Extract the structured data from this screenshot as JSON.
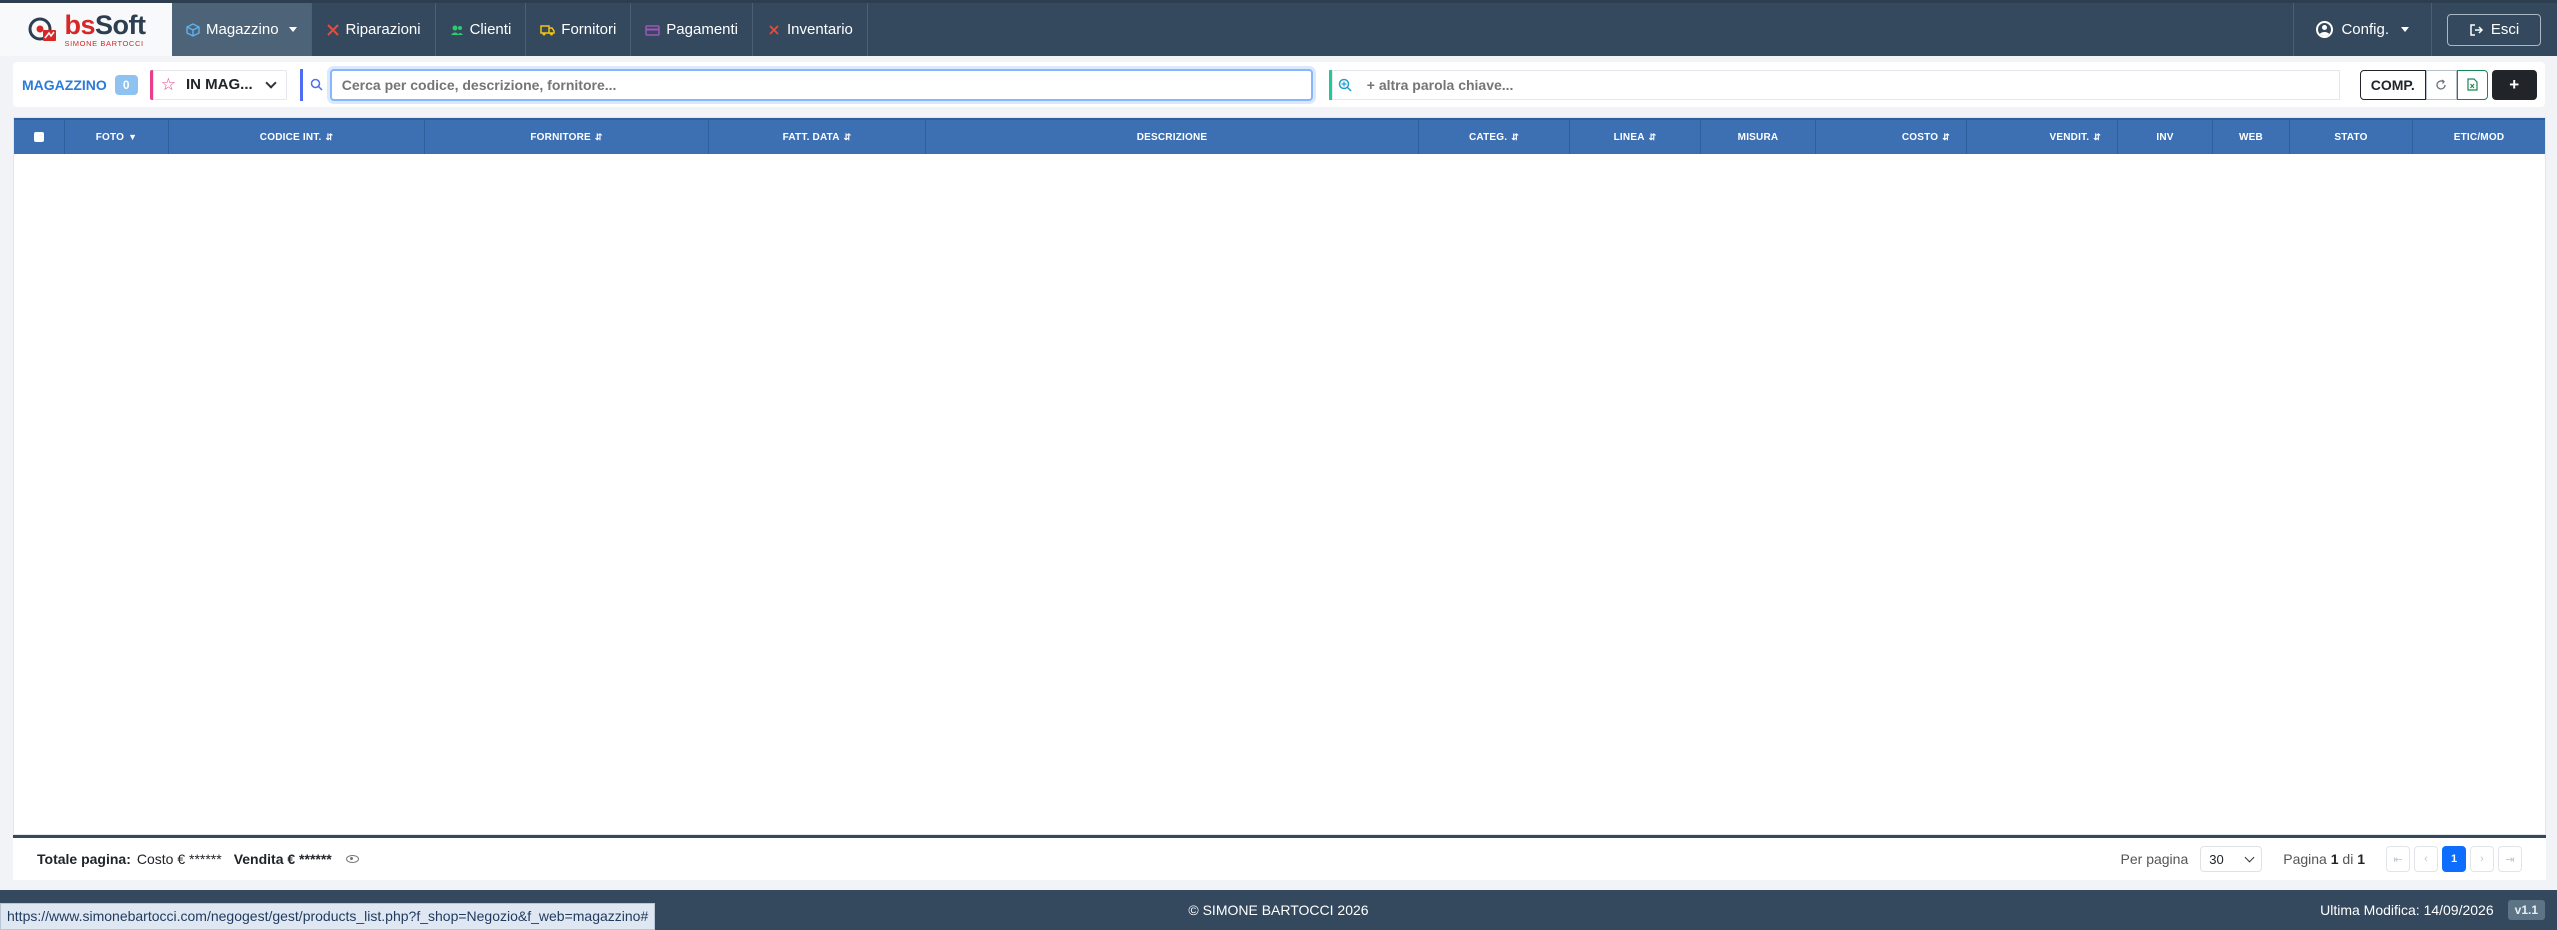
{
  "brand": {
    "name_prefix": "bs",
    "name_suffix": "Soft",
    "subtitle": "SIMONE BARTOCCI"
  },
  "nav": {
    "items": [
      {
        "label": "Magazzino",
        "icon": "box-icon",
        "color": "#5fb0f0",
        "active": true,
        "dropdown": true
      },
      {
        "label": "Riparazioni",
        "icon": "tools-icon",
        "color": "#e74c3c"
      },
      {
        "label": "Clienti",
        "icon": "users-icon",
        "color": "#2ecc71"
      },
      {
        "label": "Fornitori",
        "icon": "truck-icon",
        "color": "#f1c40f"
      },
      {
        "label": "Pagamenti",
        "icon": "card-icon",
        "color": "#9b59b6"
      },
      {
        "label": "Inventario",
        "icon": "clipboard-icon",
        "color": "#e74c3c"
      }
    ],
    "config_label": "Config.",
    "logout_label": "Esci"
  },
  "toolbar": {
    "section_label": "MAGAZZINO",
    "count": "0",
    "filter_label": "IN MAG...",
    "search_placeholder": "Cerca per codice, descrizione, fornitore...",
    "keyword_placeholder": "+ altra parola chiave...",
    "comp_label": "COMP.",
    "add_label": "+"
  },
  "table": {
    "columns": [
      {
        "label": "",
        "key": "select"
      },
      {
        "label": "FOTO",
        "sort": "▼"
      },
      {
        "label": "CODICE INT.",
        "sort": "⇵"
      },
      {
        "label": "FORNITORE",
        "sort": "⇵"
      },
      {
        "label": "FATT. DATA",
        "sort": "⇵"
      },
      {
        "label": "DESCRIZIONE"
      },
      {
        "label": "CATEG.",
        "sort": "⇵"
      },
      {
        "label": "LINEA",
        "sort": "⇵"
      },
      {
        "label": "MISURA"
      },
      {
        "label": "COSTO",
        "sort": "⇵"
      },
      {
        "label": "VENDIT.",
        "sort": "⇵"
      },
      {
        "label": "INV"
      },
      {
        "label": "WEB"
      },
      {
        "label": "STATO"
      },
      {
        "label": "ETIC/MOD"
      }
    ]
  },
  "totals": {
    "label": "Totale pagina:",
    "cost_label": "Costo € ******",
    "sale_label": "Vendita € ******"
  },
  "pager": {
    "per_page_label": "Per pagina",
    "per_page_value": "30",
    "page_prefix": "Pagina",
    "page_current": "1",
    "page_of": "di",
    "page_total": "1",
    "first": "⇤",
    "prev": "‹",
    "current": "1",
    "next": "›",
    "last": "⇥"
  },
  "footer": {
    "copyright": "© SIMONE BARTOCCI 2026",
    "last_modified": "Ultima Modifica: 14/09/2026",
    "version": "v1.1",
    "status_url": "https://www.simonebartocci.com/negogest/gest/products_list.php?f_shop=Negozio&f_web=magazzino#"
  }
}
